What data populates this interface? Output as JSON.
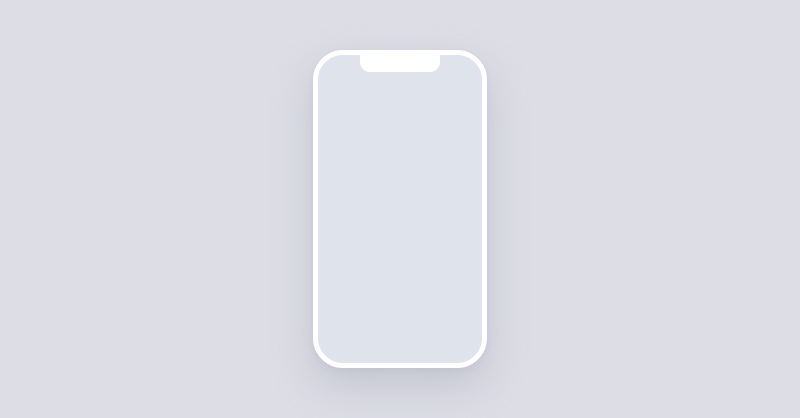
{
  "device": {
    "frame_color": "#ffffff",
    "screen_color": "#dee3ec",
    "background_color": "#dcdde5"
  }
}
